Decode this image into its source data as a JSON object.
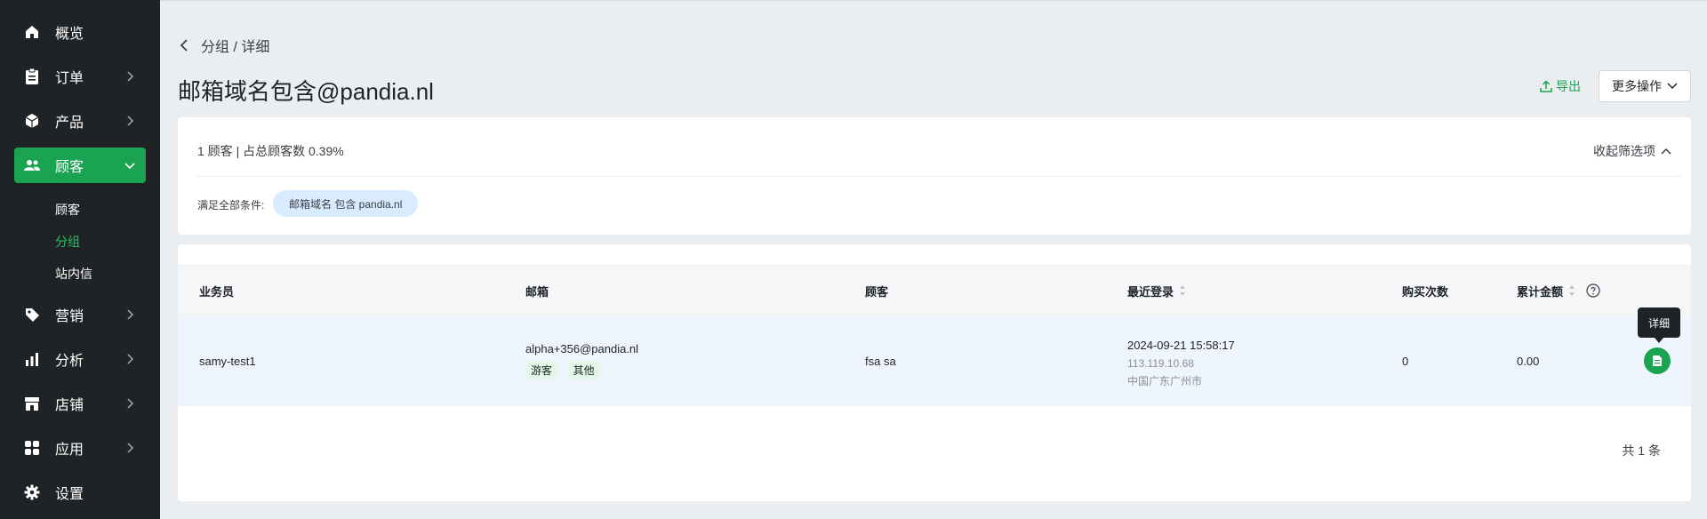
{
  "sidebar": {
    "items": [
      {
        "label": "概览",
        "icon": "home-icon"
      },
      {
        "label": "订单",
        "icon": "clipboard-icon"
      },
      {
        "label": "产品",
        "icon": "box-icon"
      },
      {
        "label": "顾客",
        "icon": "users-icon"
      },
      {
        "label": "营销",
        "icon": "tag-icon"
      },
      {
        "label": "分析",
        "icon": "bar-chart-icon"
      },
      {
        "label": "店铺",
        "icon": "store-icon"
      },
      {
        "label": "应用",
        "icon": "apps-icon"
      },
      {
        "label": "设置",
        "icon": "gear-icon"
      }
    ],
    "sub_items": [
      {
        "label": "顾客"
      },
      {
        "label": "分组"
      },
      {
        "label": "站内信"
      }
    ],
    "active_color": "#1aa350"
  },
  "header": {
    "breadcrumb": "分组 / 详细",
    "title": "邮箱域名包含@pandia.nl",
    "export_label": "导出",
    "more_label": "更多操作"
  },
  "filter": {
    "summary": "1 顾客 | 占总顾客数 0.39%",
    "collapse_label": "收起筛选项",
    "condition_label": "满足全部条件:",
    "condition_chip": "邮箱域名 包含 pandia.nl"
  },
  "table": {
    "headers": [
      "业务员",
      "邮箱",
      "顾客",
      "最近登录",
      "购买次数",
      "累计金额"
    ],
    "rows": [
      {
        "salesperson": "samy-test1",
        "email": "alpha+356@pandia.nl",
        "tags": [
          "游客",
          "其他"
        ],
        "customer": "fsa sa",
        "last_login": "2024-09-21 15:58:17",
        "ip": "113.119.10.68",
        "location": "中国广东广州市",
        "purchases": "0",
        "total_amount": "0.00"
      }
    ],
    "tooltip": "详细",
    "total": "共 1 条"
  }
}
